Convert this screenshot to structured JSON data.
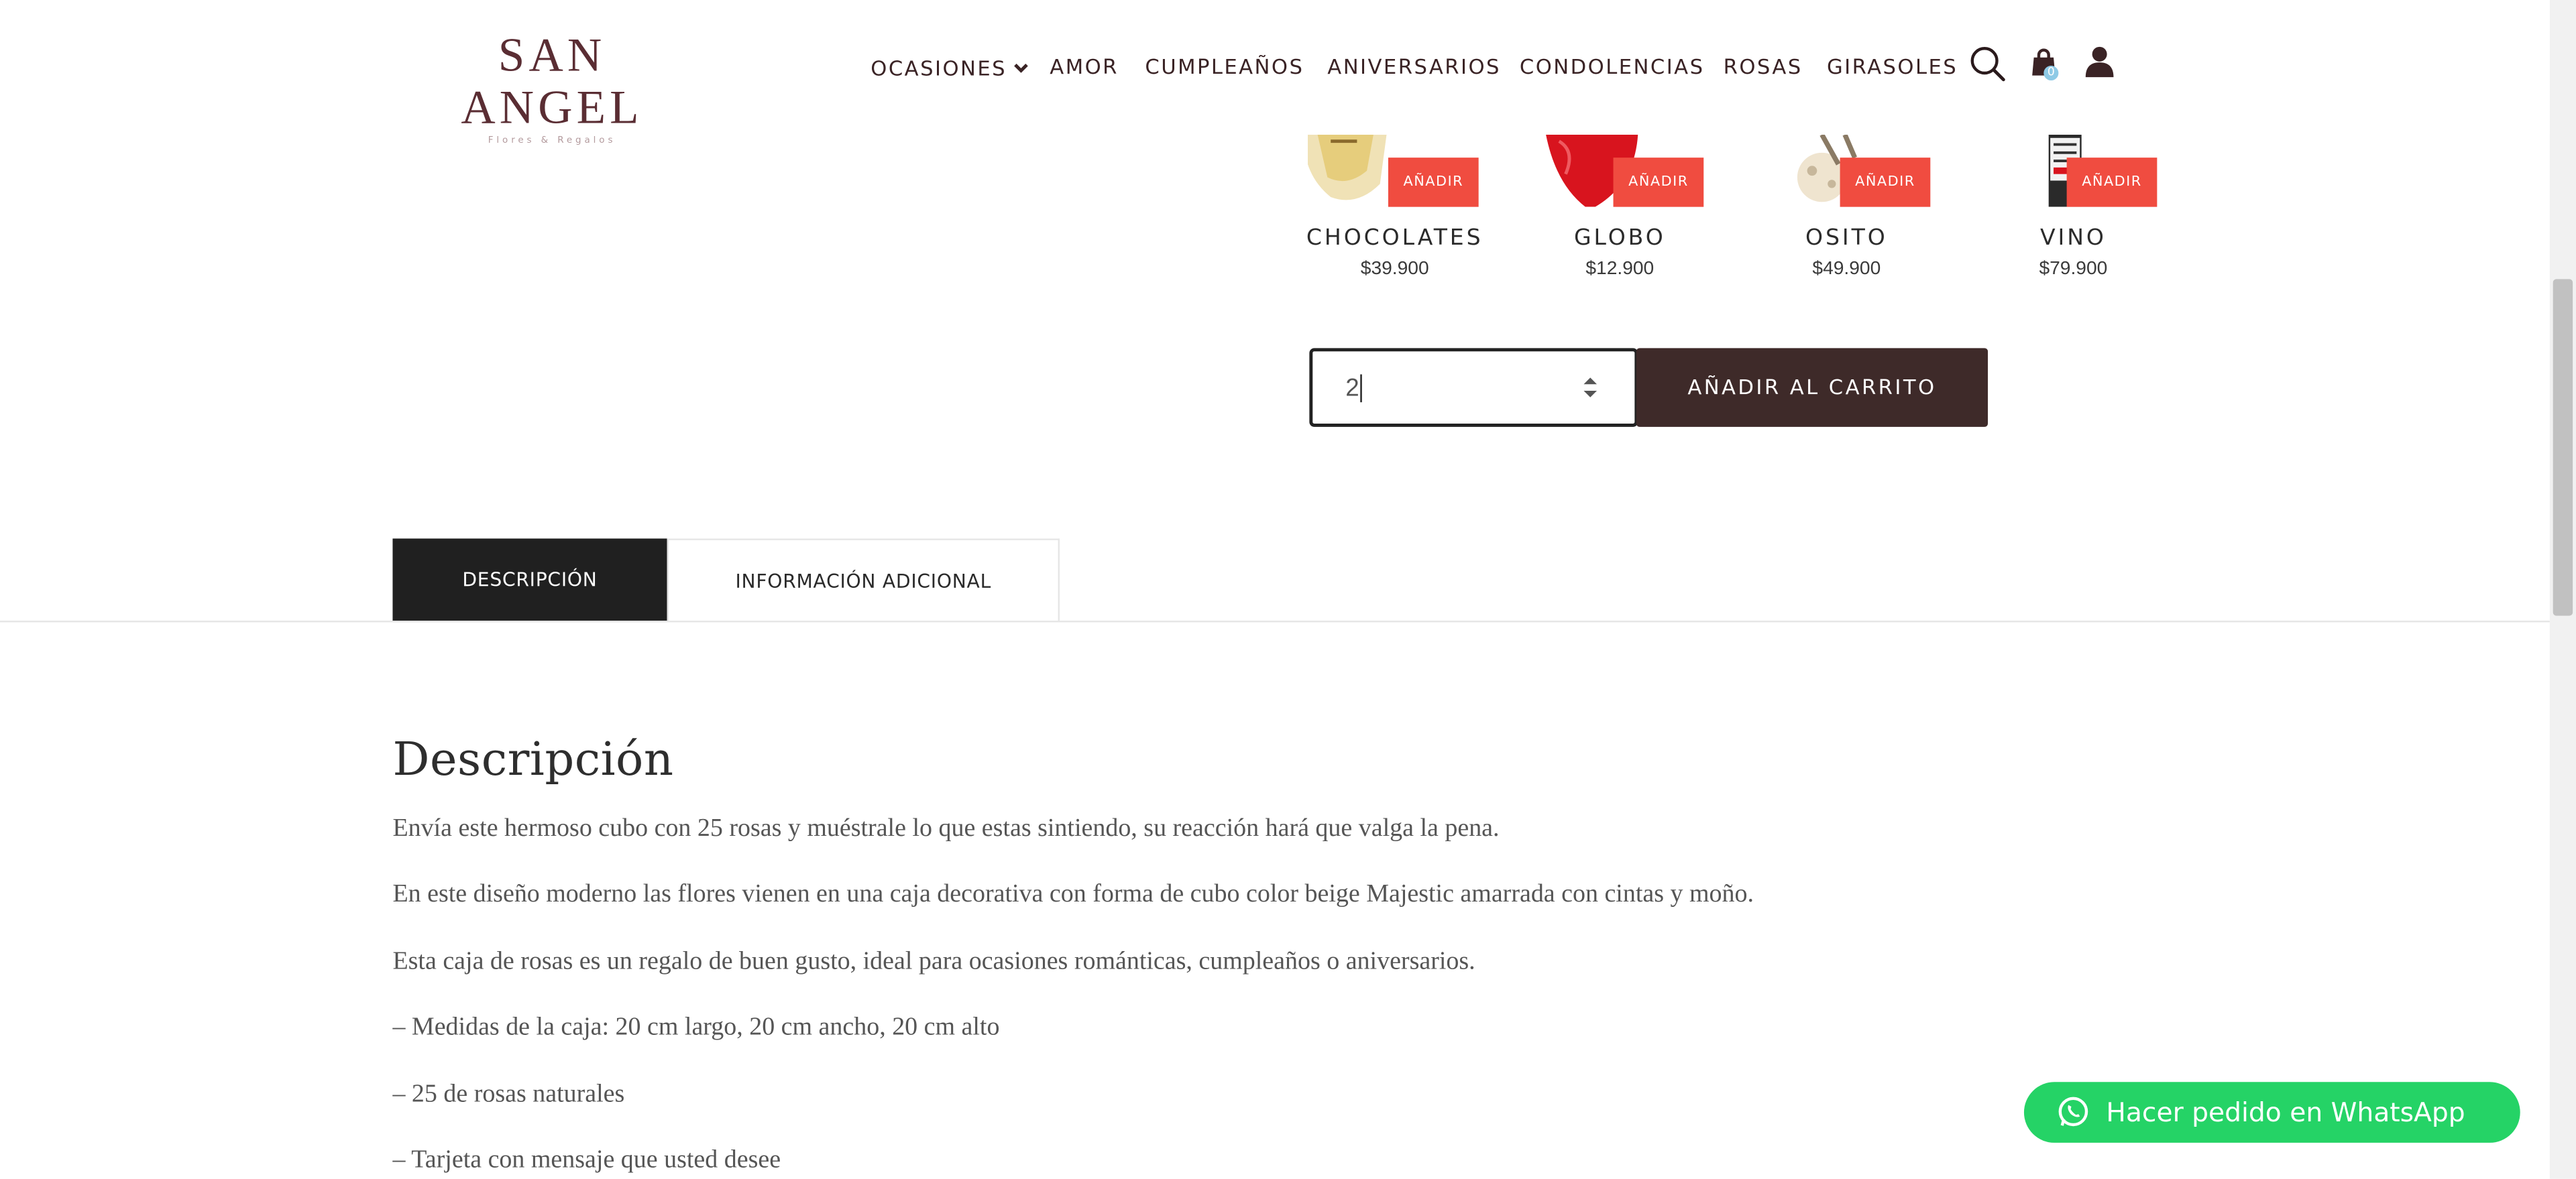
{
  "brand": {
    "name": "SAN ANGEL",
    "tagline": "Flores & Regalos"
  },
  "nav": {
    "items": [
      {
        "label": "OCASIONES"
      },
      {
        "label": "AMOR"
      },
      {
        "label": "CUMPLEAÑOS"
      },
      {
        "label": "ANIVERSARIOS"
      },
      {
        "label": "CONDOLENCIAS"
      },
      {
        "label": "ROSAS"
      },
      {
        "label": "GIRASOLES"
      }
    ],
    "cart_count": "0",
    "icons": {
      "search": "search-icon",
      "cart": "shopping-bag-icon",
      "account": "user-icon",
      "dropdown": "chevron-down-icon"
    }
  },
  "addons": [
    {
      "name": "CHOCOLATES",
      "price": "$39.900",
      "button": "AÑADIR"
    },
    {
      "name": "GLOBO",
      "price": "$12.900",
      "button": "AÑADIR"
    },
    {
      "name": "OSITO",
      "price": "$49.900",
      "button": "AÑADIR"
    },
    {
      "name": "VINO",
      "price": "$79.900",
      "button": "AÑADIR"
    }
  ],
  "quantity": {
    "value": "2"
  },
  "add_to_cart_label": "AÑADIR AL CARRITO",
  "tabs": [
    {
      "label": "DESCRIPCIÓN",
      "active": true
    },
    {
      "label": "INFORMACIÓN ADICIONAL",
      "active": false
    }
  ],
  "description": {
    "title": "Descripción",
    "paragraphs": [
      "Envía este hermoso cubo con 25 rosas y muéstrale lo que estas sintiendo, su reacción hará que valga la pena.",
      "En este diseño moderno las flores vienen en una caja decorativa con forma de cubo color beige Majestic amarrada con cintas y moño.",
      "Esta caja de rosas es un regalo de buen gusto, ideal para ocasiones románticas, cumpleaños o aniversarios.",
      "– Medidas de la caja: 20 cm largo, 20 cm ancho, 20 cm alto",
      "– 25 de rosas naturales",
      "– Tarjeta con mensaje que usted desee"
    ]
  },
  "whatsapp": {
    "label": "Hacer pedido en WhatsApp"
  },
  "colors": {
    "brand": "#5a2d33",
    "accent": "#f04c40",
    "dark_button": "#3e2a29",
    "whatsapp": "#25d366",
    "tab_active": "#202020"
  }
}
